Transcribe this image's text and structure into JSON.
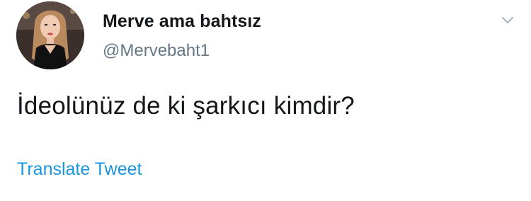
{
  "tweet": {
    "author": {
      "display_name": "Merve ama bahtsız",
      "handle": "@Mervebaht1",
      "avatar_icon": "profile-photo"
    },
    "text": "İdeolünüz de ki şarkıcı kimdir?",
    "translate_label": "Translate Tweet",
    "menu_icon": "chevron-down-icon"
  },
  "colors": {
    "text": "#14171a",
    "secondary": "#657786",
    "link": "#1b95e0",
    "chevron": "#aab8c2"
  }
}
